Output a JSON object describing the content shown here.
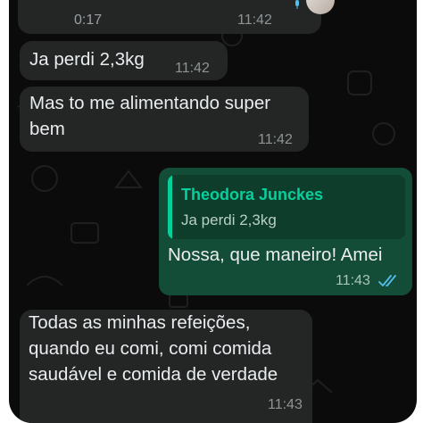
{
  "messages": [
    {
      "id": "voice",
      "duration": "0:17",
      "time": "11:42"
    },
    {
      "id": "m1",
      "text": "Ja perdi 2,3kg",
      "time": "11:42"
    },
    {
      "id": "m2",
      "text": "Mas to me alimentando super\nbem",
      "time": "11:42"
    },
    {
      "id": "m3",
      "quoted_name": "Theodora Junckes",
      "quoted_text": "Ja perdi 2,3kg",
      "text": "Nossa, que maneiro! Amei",
      "time": "11:43",
      "status_icon": "double-check-read-icon"
    },
    {
      "id": "m4",
      "text": "Todas as minhas refeições,\nquando eu comi, comi comida\nsaudável e comida de verdade",
      "time": "11:43"
    }
  ],
  "colors": {
    "background": "#0b0b0b",
    "incoming_bubble": "#242626",
    "outgoing_bubble": "#144d37",
    "quote_accent": "#06cf9c",
    "read_ticks": "#53bdeb"
  }
}
